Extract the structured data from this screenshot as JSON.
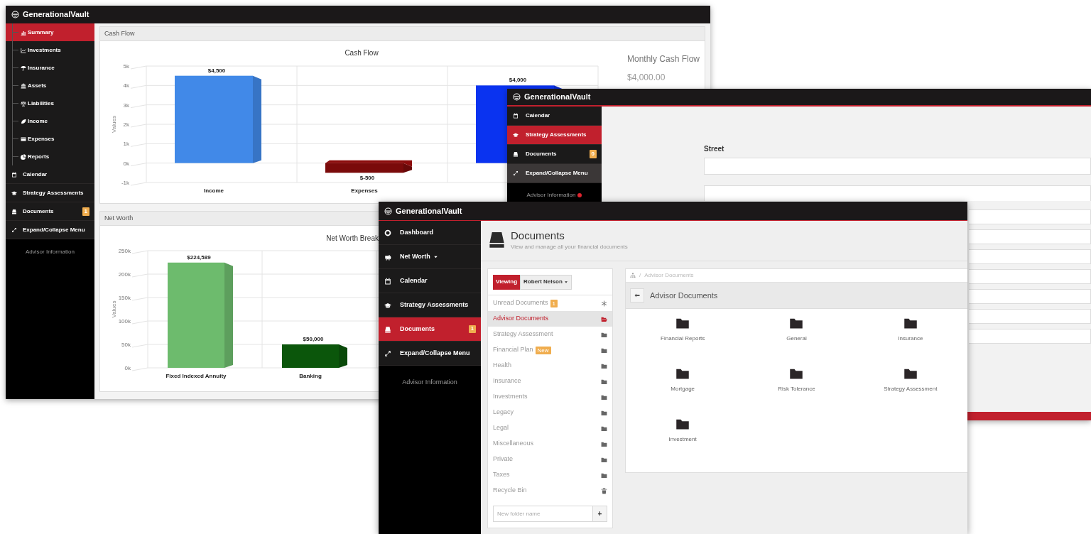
{
  "windows": [
    {
      "kind": "summary",
      "app_name": "GenerationalVault",
      "sidebar": {
        "items": [
          {
            "kind": "sub",
            "label": "Summary",
            "selected": true
          },
          {
            "kind": "sub",
            "label": "Investments",
            "selected": false
          },
          {
            "kind": "sub",
            "label": "Insurance",
            "selected": false
          },
          {
            "kind": "sub",
            "label": "Assets",
            "selected": false
          },
          {
            "kind": "sub",
            "label": "Liabilities",
            "selected": false
          },
          {
            "kind": "sub",
            "label": "Income",
            "selected": false
          },
          {
            "kind": "sub",
            "label": "Expenses",
            "selected": false
          },
          {
            "kind": "sub",
            "label": "Reports",
            "selected": false
          },
          {
            "kind": "main",
            "label": "Calendar",
            "selected": false
          },
          {
            "kind": "main",
            "label": "Strategy Assessments",
            "selected": false
          },
          {
            "kind": "main",
            "label": "Documents",
            "selected": false,
            "badge": "1"
          },
          {
            "kind": "main",
            "label": "Expand/Collapse Menu",
            "selected": false
          }
        ],
        "advisor_link": "Advisor Information",
        "advisor_alert": false
      },
      "panels": [
        {
          "title": "Cash Flow",
          "summary": {
            "label": "Monthly Cash Flow",
            "value": "$4,000.00"
          },
          "chart_data": {
            "type": "bar",
            "title": "Cash Flow",
            "ylabel": "Values",
            "categories": [
              "Income",
              "Expenses",
              null
            ],
            "values": [
              4500,
              -500,
              4000
            ],
            "colors": [
              "#4189e8",
              "#7a0a0a",
              "#0a33f0"
            ],
            "ylim": [
              -1000,
              5000
            ],
            "yticks": [
              {
                "value": -1000,
                "label": "-1k"
              },
              {
                "value": 0,
                "label": "0k"
              },
              {
                "value": 1000,
                "label": "1k"
              },
              {
                "value": 2000,
                "label": "2k"
              },
              {
                "value": 3000,
                "label": "3k"
              },
              {
                "value": 4000,
                "label": "4k"
              },
              {
                "value": 5000,
                "label": "5k"
              }
            ],
            "value_labels": [
              "$4,500",
              "$-500",
              "$4,000"
            ]
          }
        },
        {
          "title": "Net Worth",
          "chart_data": {
            "type": "bar",
            "title": "Net Worth Break",
            "ylabel": "Values",
            "categories": [
              "Fixed Indexed Annuity",
              "Banking"
            ],
            "values": [
              224589,
              50000
            ],
            "colors": [
              "#6dbb6d",
              "#0b560b"
            ],
            "ylim": [
              0,
              250000
            ],
            "yticks": [
              {
                "value": 0,
                "label": "0k"
              },
              {
                "value": 50000,
                "label": "50k"
              },
              {
                "value": 100000,
                "label": "100k"
              },
              {
                "value": 150000,
                "label": "150k"
              },
              {
                "value": 200000,
                "label": "200k"
              },
              {
                "value": 250000,
                "label": "250k"
              }
            ],
            "value_labels": [
              "$224,589",
              "$50,000"
            ]
          }
        }
      ]
    },
    {
      "kind": "form",
      "app_name": "GenerationalVault",
      "sidebar": {
        "items": [
          {
            "kind": "main",
            "label": "Calendar",
            "selected": false,
            "hovered": false
          },
          {
            "kind": "main",
            "label": "Strategy Assessments",
            "selected": true,
            "hovered": false
          },
          {
            "kind": "main",
            "label": "Documents",
            "selected": false,
            "hovered": false,
            "badge": "0"
          },
          {
            "kind": "main",
            "label": "Expand/Collapse Menu",
            "selected": false,
            "hovered": true
          }
        ],
        "advisor_link": "Advisor Information",
        "advisor_alert": true
      },
      "form": {
        "label": "Street"
      }
    },
    {
      "kind": "documents",
      "app_name": "GenerationalVault",
      "sidebar": {
        "items": [
          {
            "kind": "main",
            "label": "Dashboard",
            "selected": false
          },
          {
            "kind": "main",
            "label": "Net Worth",
            "selected": false,
            "dropdown": true
          },
          {
            "kind": "main",
            "label": "Calendar",
            "selected": false
          },
          {
            "kind": "main",
            "label": "Strategy Assessments",
            "selected": false
          },
          {
            "kind": "main",
            "label": "Documents",
            "selected": true,
            "badge": "1"
          },
          {
            "kind": "main",
            "label": "Expand/Collapse Menu",
            "selected": false
          }
        ],
        "advisor_link": "Advisor Information",
        "advisor_alert": false
      },
      "page": {
        "title": "Documents",
        "subtitle": "View and manage all your financial documents"
      },
      "viewing": {
        "label": "Viewing",
        "user": "Robert Nelson"
      },
      "folder_list": [
        {
          "kind": "unread",
          "label": "Unread Documents",
          "selected": false,
          "badge": "1"
        },
        {
          "kind": "folder",
          "label": "Advisor Documents",
          "selected": true
        },
        {
          "kind": "folder",
          "label": "Strategy Assessment",
          "selected": false
        },
        {
          "kind": "folder",
          "label": "Financial Plan",
          "selected": false,
          "badge": "New"
        },
        {
          "kind": "folder",
          "label": "Health",
          "selected": false
        },
        {
          "kind": "folder",
          "label": "Insurance",
          "selected": false
        },
        {
          "kind": "folder",
          "label": "Investments",
          "selected": false
        },
        {
          "kind": "folder",
          "label": "Legacy",
          "selected": false
        },
        {
          "kind": "folder",
          "label": "Legal",
          "selected": false
        },
        {
          "kind": "folder",
          "label": "Miscellaneous",
          "selected": false
        },
        {
          "kind": "folder",
          "label": "Private",
          "selected": false
        },
        {
          "kind": "folder",
          "label": "Taxes",
          "selected": false
        },
        {
          "kind": "trash",
          "label": "Recycle Bin",
          "selected": false
        }
      ],
      "new_folder": {
        "placeholder": "New folder name",
        "button": "+"
      },
      "breadcrumb": {
        "separator": "/",
        "current": "Advisor Documents"
      },
      "folder_title": "Advisor Documents",
      "folders": [
        "Financial Reports",
        "General",
        "Insurance",
        "Mortgage",
        "Risk Tolerance",
        "Strategy Assessment",
        "Investment"
      ]
    }
  ]
}
